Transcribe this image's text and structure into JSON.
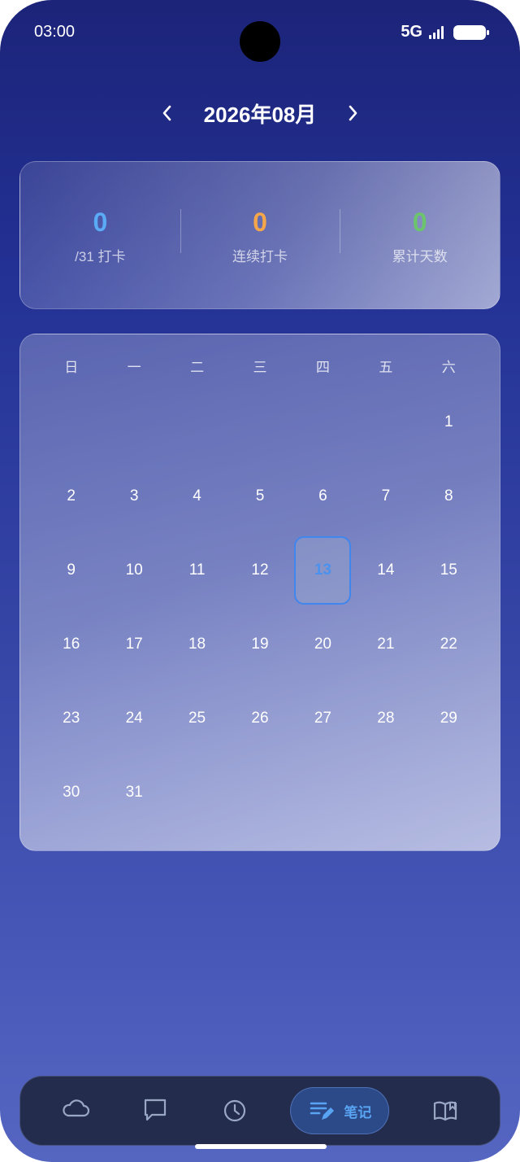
{
  "status_bar": {
    "time": "03:00",
    "network": "5G"
  },
  "header": {
    "month_title": "2026年08月"
  },
  "stats": [
    {
      "value": "0",
      "label": "/31 打卡",
      "color": "#5aaaf5"
    },
    {
      "value": "0",
      "label": "连续打卡",
      "color": "#f6a64a"
    },
    {
      "value": "0",
      "label": "累计天数",
      "color": "#6cc46c"
    }
  ],
  "calendar": {
    "weekdays": [
      "日",
      "一",
      "二",
      "三",
      "四",
      "五",
      "六"
    ],
    "leading_blanks": 6,
    "days": [
      "1",
      "2",
      "3",
      "4",
      "5",
      "6",
      "7",
      "8",
      "9",
      "10",
      "11",
      "12",
      "13",
      "14",
      "15",
      "16",
      "17",
      "18",
      "19",
      "20",
      "21",
      "22",
      "23",
      "24",
      "25",
      "26",
      "27",
      "28",
      "29",
      "30",
      "31"
    ],
    "today": "13"
  },
  "nav": {
    "tabs": [
      {
        "icon": "cloud-icon",
        "label": "",
        "active": false
      },
      {
        "icon": "chat-icon",
        "label": "",
        "active": false
      },
      {
        "icon": "clock-icon",
        "label": "",
        "active": false
      },
      {
        "icon": "notes-edit-icon",
        "label": "笔记",
        "active": true
      },
      {
        "icon": "book-icon",
        "label": "",
        "active": false
      }
    ]
  }
}
